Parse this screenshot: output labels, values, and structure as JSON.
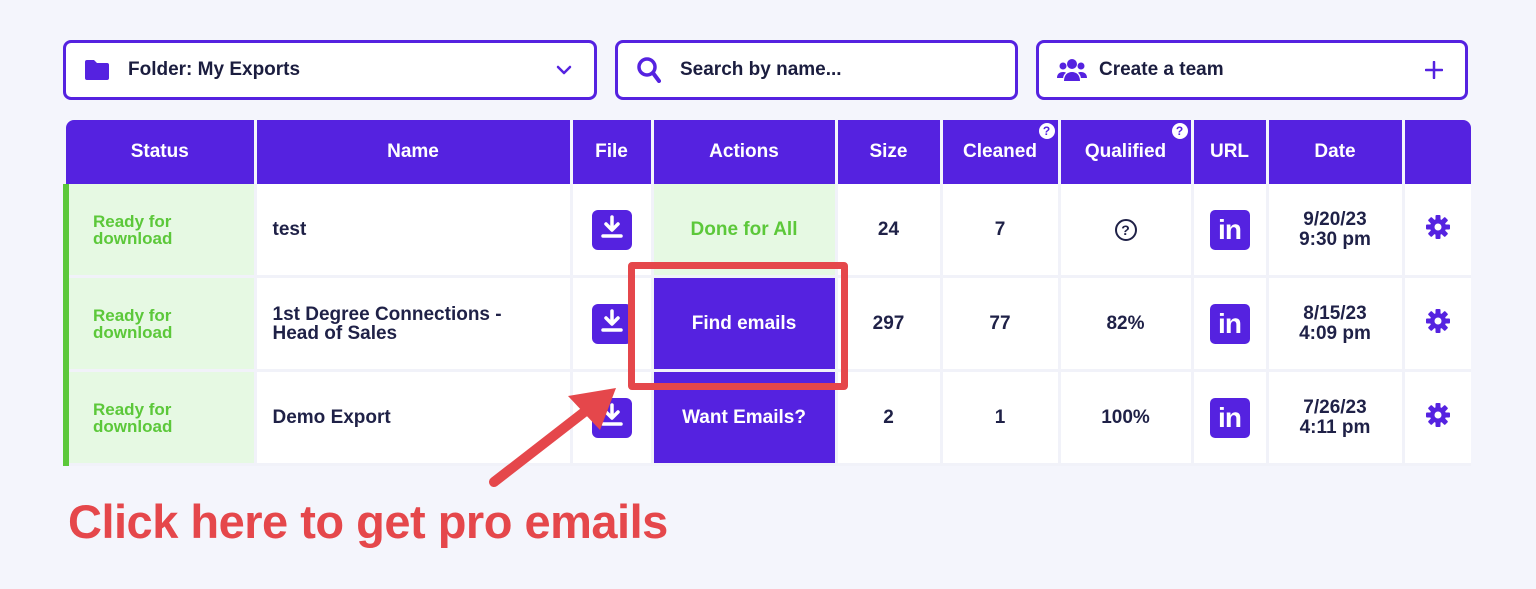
{
  "toolbar": {
    "folder_label": "Folder: My Exports",
    "search_placeholder": "Search by name...",
    "team_label": "Create a team"
  },
  "columns": [
    "Status",
    "Name",
    "File",
    "Actions",
    "Size",
    "Cleaned",
    "Qualified",
    "URL",
    "Date",
    ""
  ],
  "rows": [
    {
      "status_line1": "Ready for",
      "status_line2": "download",
      "name_line1": "test",
      "name_line2": "",
      "action": "Done for All",
      "action_style": "done",
      "size": "24",
      "cleaned": "7",
      "qualified": "",
      "date_line1": "9/20/23",
      "date_line2": "9:30 pm"
    },
    {
      "status_line1": "Ready for",
      "status_line2": "download",
      "name_line1": "1st Degree Connections -",
      "name_line2": "Head of Sales",
      "action": "Find emails",
      "action_style": "button",
      "size": "297",
      "cleaned": "77",
      "qualified": "82%",
      "date_line1": "8/15/23",
      "date_line2": "4:09 pm"
    },
    {
      "status_line1": "Ready for",
      "status_line2": "download",
      "name_line1": "Demo Export",
      "name_line2": "",
      "action": "Want Emails?",
      "action_style": "button",
      "size": "2",
      "cleaned": "1",
      "qualified": "100%",
      "date_line1": "7/26/23",
      "date_line2": "4:11 pm"
    }
  ],
  "linkedin_glyph": "in",
  "header_help_glyph": "?",
  "callout_text": "Click here to get pro emails",
  "colors": {
    "accent": "#5522e0",
    "success": "#5cc83a",
    "success_bg": "#e6f9e3",
    "annotation": "#e5474b"
  }
}
